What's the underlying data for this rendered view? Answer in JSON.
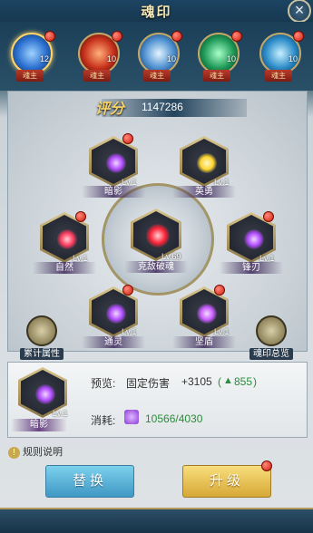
{
  "window": {
    "title": "魂印",
    "close_icon": "×"
  },
  "avatars": [
    {
      "level": "12",
      "tag": "魂主",
      "color": "#4fa8ff",
      "has_badge": true
    },
    {
      "level": "10",
      "tag": "魂主",
      "color": "#ff5a3a",
      "has_badge": true
    },
    {
      "level": "10",
      "tag": "魂主",
      "color": "#8fd0ff",
      "has_badge": true
    },
    {
      "level": "10",
      "tag": "魂主",
      "color": "#4be08b",
      "has_badge": true
    },
    {
      "level": "10",
      "tag": "魂主",
      "color": "#6fd4ff",
      "has_badge": true
    }
  ],
  "score": {
    "label": "评分",
    "value": "1147286"
  },
  "slots": {
    "top_left": {
      "name": "暗影",
      "level": "Lv.1",
      "glow": "#b14cff"
    },
    "top_right": {
      "name": "英勇",
      "level": "Lv.1",
      "glow": "#ffe24a"
    },
    "left": {
      "name": "自然",
      "level": "Lv.1",
      "glow": "#ff4b6a"
    },
    "center": {
      "name": "克敌破魂",
      "level": "Lv.69",
      "glow": "#ff3344"
    },
    "right": {
      "name": "锋刃",
      "level": "Lv.1",
      "glow": "#b14cff"
    },
    "bottom_left": {
      "name": "通灵",
      "level": "Lv.1",
      "glow": "#b14cff"
    },
    "bottom_right": {
      "name": "坚盾",
      "level": "Lv.1",
      "glow": "#c85bff"
    }
  },
  "side_buttons": {
    "left_label": "累计属性",
    "right_label": "魂印总览"
  },
  "info": {
    "name": "暗影",
    "level": "Lv.1",
    "preview_label": "预览:",
    "preview_text": "固定伤害",
    "preview_value": "+3105",
    "preview_power_open": "(",
    "preview_power": "855",
    "preview_power_close": ")",
    "cost_label": "消耗:",
    "cost_value": "10566/4030"
  },
  "rules_label": "规则说明",
  "buttons": {
    "swap": "替换",
    "upgrade": "升级"
  }
}
